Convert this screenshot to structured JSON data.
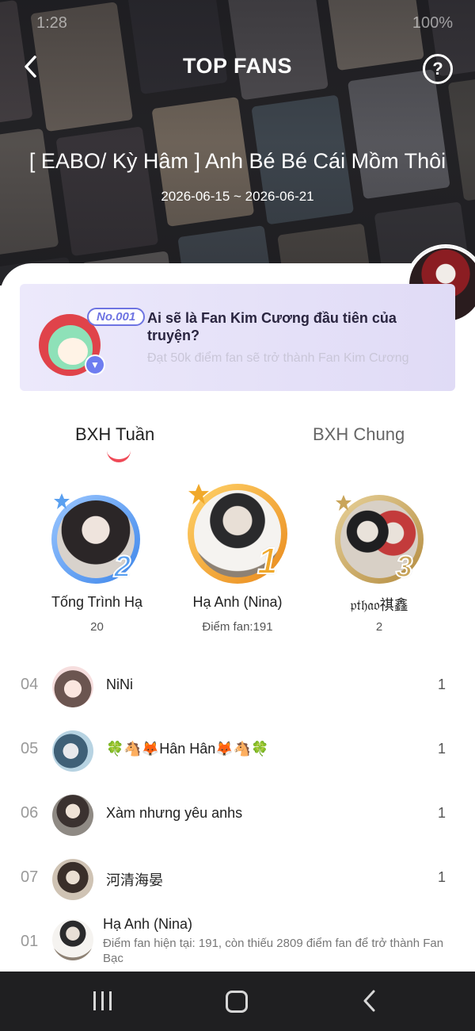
{
  "status_bar": {
    "time": "1:28",
    "battery": "100%"
  },
  "header": {
    "title": "TOP FANS",
    "help_label": "?",
    "comic_name": "[ EABO/ Kỳ Hâm ] Anh Bé Bé Cái Mồm Thôi",
    "date_range": "2026-06-15 ~ 2026-06-21"
  },
  "banner": {
    "badge": "No.001",
    "title": "Ai sẽ là Fan Kim Cương đầu tiên của truyện?",
    "subtitle": "Đạt 50k điểm fan sẽ trở thành Fan Kim Cương"
  },
  "tabs": [
    {
      "label": "BXH Tuần",
      "active": true
    },
    {
      "label": "BXH Chung",
      "active": false
    }
  ],
  "podium": [
    {
      "rank": "2",
      "name": "Tống Trình Hạ",
      "score": "20"
    },
    {
      "rank": "1",
      "name": "Hạ Anh (Nina)",
      "score": "Điểm fan:191"
    },
    {
      "rank": "3",
      "name": "𝔭𝔱𝔥𝔞𝔬祺鑫",
      "score": "2"
    }
  ],
  "list": [
    {
      "rank": "04",
      "name": "NiNi",
      "score": "1"
    },
    {
      "rank": "05",
      "name": "🍀🐴🦊Hân Hân🦊🐴🍀",
      "score": "1"
    },
    {
      "rank": "06",
      "name": "Xàm nhưng yêu anhs",
      "score": "1"
    },
    {
      "rank": "07",
      "name": "河清海晏",
      "score": "1"
    }
  ],
  "my_rank": {
    "rank": "01",
    "name": "Hạ Anh (Nina)",
    "description": "Điểm fan hiện tại: 191, còn thiếu 2809 điểm fan để trở thành Fan Bạc"
  },
  "colors": {
    "accent_red": "#ef4a57",
    "gold": "#f0a92c",
    "silver_blue": "#5aa0f0",
    "bronze": "#c9a55a",
    "banner_purple": "#6e74e2"
  }
}
